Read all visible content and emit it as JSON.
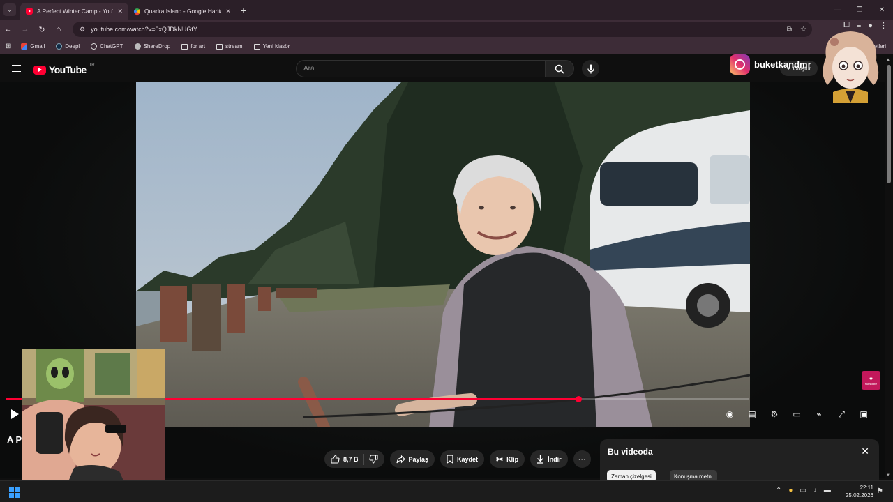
{
  "browser": {
    "tabs": [
      {
        "title": "A Perfect Winter Camp - YouTu",
        "favicon": "youtube-icon",
        "active": true
      },
      {
        "title": "Quadra Island - Google Haritala",
        "favicon": "google-maps-icon",
        "active": false
      }
    ],
    "url": "youtube.com/watch?v=6xQJDkNUGtY",
    "bookmarks": [
      "Gmail",
      "Deepl",
      "ChatGPT",
      "ShareDrop",
      "for art",
      "stream",
      "Yeni klasör"
    ],
    "bookmarks_other": "etleri"
  },
  "youtube": {
    "logo_text": "YouTube",
    "logo_country": "TR",
    "search_placeholder": "Ara",
    "create_label": "Oluştur"
  },
  "overlay": {
    "instagram_handle": "buketkandmr"
  },
  "player": {
    "progress": 0.77,
    "state": "paused"
  },
  "video_info": {
    "title_partial": "A P",
    "like_count": "8,7 B",
    "share_label": "Paylaş",
    "save_label": "Kaydet",
    "clip_label": "Klip",
    "download_label": "İndir"
  },
  "side_panel": {
    "title": "Bu videoda",
    "chips": [
      "Zaman çizelgesi",
      "Konuşma metni"
    ]
  },
  "subscribe_badge": "subscribe",
  "taskbar": {
    "time": "22:11",
    "date": "25.02.2026"
  },
  "colors": {
    "accent_red": "#ff0033",
    "browser_frame": "#3d2c37",
    "page_bg": "#0f0f0f"
  }
}
